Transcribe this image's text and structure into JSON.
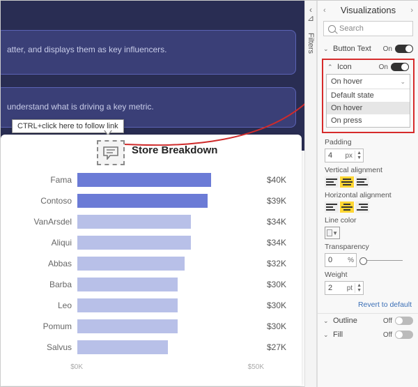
{
  "canvas": {
    "frag1": "atter, and displays them as key influencers.",
    "frag2": "understand what is driving a key metric.",
    "tooltip": "CTRL+click here to follow link",
    "chart_title": "Store Breakdown"
  },
  "chart_data": {
    "type": "bar",
    "orientation": "horizontal",
    "title": "Store Breakdown",
    "xlabel": "",
    "ylabel": "",
    "xlim": [
      0,
      50
    ],
    "value_prefix": "$",
    "value_suffix": "K",
    "axis_ticks": [
      "$0K",
      "$50K"
    ],
    "categories": [
      "Fama",
      "Contoso",
      "VanArsdel",
      "Aliqui",
      "Abbas",
      "Barba",
      "Leo",
      "Pomum",
      "Salvus"
    ],
    "values": [
      40,
      39,
      34,
      34,
      32,
      30,
      30,
      30,
      27
    ],
    "colors": [
      "#6b7bd6",
      "#6b7bd6",
      "#b8c0e8",
      "#b8c0e8",
      "#b8c0e8",
      "#b8c0e8",
      "#b8c0e8",
      "#b8c0e8",
      "#b8c0e8"
    ]
  },
  "filters": {
    "label": "Filters"
  },
  "pane": {
    "title": "Visualizations",
    "search_placeholder": "Search",
    "button_text": {
      "label": "Button Text",
      "state": "On"
    },
    "icon": {
      "label": "Icon",
      "state": "On"
    },
    "dropdown": {
      "selected": "On hover",
      "options": [
        "Default state",
        "On hover",
        "On press"
      ]
    },
    "padding": {
      "label": "Padding",
      "value": "4",
      "unit": "px"
    },
    "valign": {
      "label": "Vertical alignment"
    },
    "halign": {
      "label": "Horizontal alignment"
    },
    "line_color": {
      "label": "Line color"
    },
    "transparency": {
      "label": "Transparency",
      "value": "0",
      "unit": "%"
    },
    "weight": {
      "label": "Weight",
      "value": "2",
      "unit": "pt"
    },
    "revert": "Revert to default",
    "outline": {
      "label": "Outline",
      "state": "Off"
    },
    "fill": {
      "label": "Fill",
      "state": "Off"
    }
  }
}
